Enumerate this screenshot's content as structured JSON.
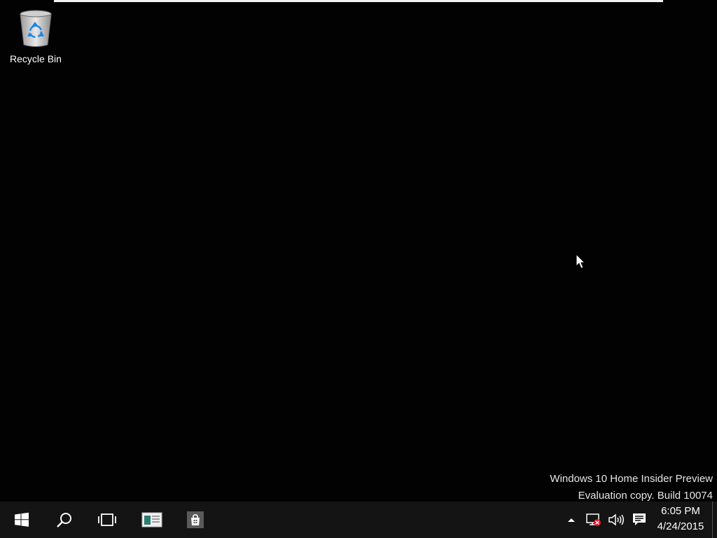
{
  "desktop": {
    "icons": [
      {
        "label": "Recycle Bin",
        "icon": "recycle-bin-icon"
      }
    ],
    "watermark": {
      "line1": "Windows 10 Home Insider Preview",
      "line2": "Evaluation copy. Build 10074"
    }
  },
  "taskbar": {
    "start_icon": "windows-logo-icon",
    "search_icon": "search-icon",
    "taskview_icon": "task-view-icon",
    "pinned": [
      {
        "icon": "file-explorer-icon"
      },
      {
        "icon": "store-icon"
      }
    ],
    "tray": {
      "chevron_icon": "chevron-up-icon",
      "network_icon": "network-disconnected-icon",
      "volume_icon": "volume-icon",
      "action_center_icon": "action-center-icon",
      "time": "6:05 PM",
      "date": "4/24/2015"
    }
  },
  "colors": {
    "desktop_bg": "#020202",
    "taskbar_bg": "#141414",
    "text": "#ffffff",
    "network_error": "#e81123"
  }
}
